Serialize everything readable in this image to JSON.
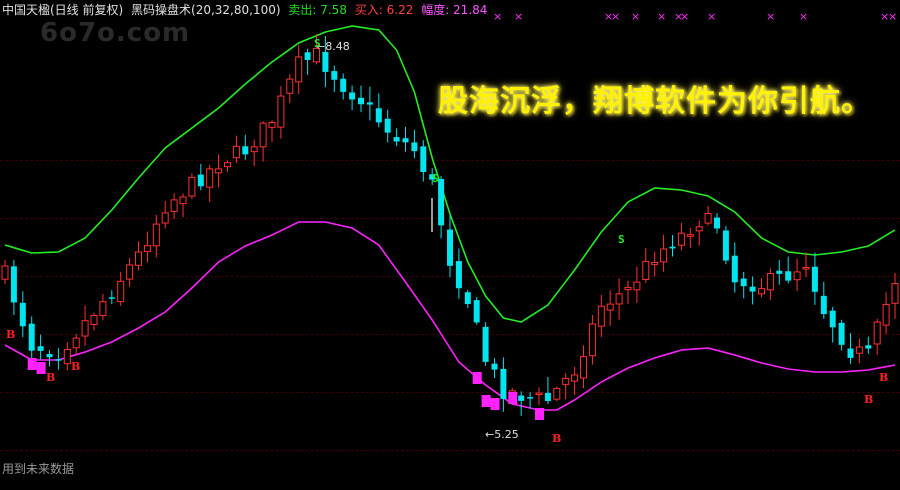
{
  "header": {
    "stock": "中国天楹(日线 前复权)",
    "indicator": "黑码操盘术(20,32,80,100)",
    "sell_label": "卖出: 7.58",
    "buy_label": "买入: 6.22",
    "range_label": "幅度: 21.84",
    "colors": {
      "title": "#e0e0e0",
      "indicator": "#e0e0e0",
      "sell": "#22dd22",
      "buy": "#ff4040",
      "range": "#ff55ff"
    }
  },
  "watermark": "6o7o.com",
  "slogan": "股海沉浮，翔博软件为你引航。",
  "footnote": "用到未来数据",
  "chart_data": {
    "type": "line",
    "title": "中国天楹(日线 前复权)",
    "candle_count": 101,
    "annotations": {
      "high": "8.48",
      "low": "5.25",
      "buy_marker": "B",
      "sell_marker": "S",
      "top_marker": "×"
    },
    "buy_signal_count": 5,
    "sell_signal_count": 3,
    "price_range": [
      5.25,
      8.48
    ],
    "series": [
      {
        "name": "",
        "color": "#22ee22"
      },
      {
        "name": "",
        "color": "#ff22ff"
      }
    ],
    "colors": {
      "up": "#ff3030",
      "down": "#00e5ee",
      "upper_band": "#22ee22",
      "lower_band": "#ff22ff",
      "buy": "#ff2020",
      "sell": "#22ee22",
      "x_marks": "#ff33ff"
    }
  }
}
